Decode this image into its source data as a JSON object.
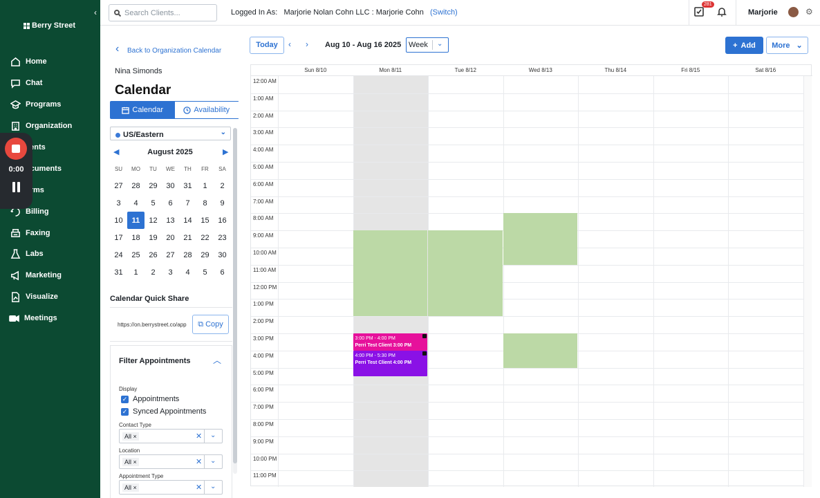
{
  "brand": {
    "name": "Berry Street"
  },
  "sidebar": {
    "items": [
      {
        "label": "Home",
        "icon": "home-icon"
      },
      {
        "label": "Chat",
        "icon": "chat-icon"
      },
      {
        "label": "Programs",
        "icon": "programs-icon"
      },
      {
        "label": "Organization",
        "icon": "organization-icon"
      },
      {
        "label": "lients",
        "icon": "clients-icon"
      },
      {
        "label": "ocuments",
        "icon": "documents-icon"
      },
      {
        "label": "orms",
        "icon": "forms-icon"
      },
      {
        "label": "Billing",
        "icon": "billing-icon"
      },
      {
        "label": "Faxing",
        "icon": "faxing-icon"
      },
      {
        "label": "Labs",
        "icon": "labs-icon"
      },
      {
        "label": "Marketing",
        "icon": "marketing-icon"
      },
      {
        "label": "Visualize",
        "icon": "visualize-icon"
      },
      {
        "label": "Meetings",
        "icon": "meetings-icon"
      }
    ]
  },
  "recorder": {
    "time": "0:00"
  },
  "topbar": {
    "search_placeholder": "Search Clients...",
    "logged_in_label": "Logged In As:",
    "logged_in_value": "Marjorie Nolan Cohn LLC : Marjorie Cohn",
    "switch_label": "(Switch)",
    "task_badge": "281",
    "user_name": "Marjorie"
  },
  "left": {
    "back_label": "Back to Organization Calendar",
    "person": "Nina Simonds",
    "title": "Calendar",
    "tab_calendar": "Calendar",
    "tab_availability": "Availability",
    "timezone": "US/Eastern",
    "month_title": "August 2025",
    "weekdays": [
      "SU",
      "MO",
      "TU",
      "WE",
      "TH",
      "FR",
      "SA"
    ],
    "weeks": [
      [
        "27",
        "28",
        "29",
        "30",
        "31",
        "1",
        "2"
      ],
      [
        "3",
        "4",
        "5",
        "6",
        "7",
        "8",
        "9"
      ],
      [
        "10",
        "11",
        "12",
        "13",
        "14",
        "15",
        "16"
      ],
      [
        "17",
        "18",
        "19",
        "20",
        "21",
        "22",
        "23"
      ],
      [
        "24",
        "25",
        "26",
        "27",
        "28",
        "29",
        "30"
      ],
      [
        "31",
        "1",
        "2",
        "3",
        "4",
        "5",
        "6"
      ]
    ],
    "selected_day": "11",
    "quick_share_title": "Calendar Quick Share",
    "quick_share_link": "https://on.berrystreet.co/app",
    "copy_label": "Copy",
    "filter_title": "Filter Appointments",
    "display_label": "Display",
    "check_appointments": "Appointments",
    "check_synced": "Synced Appointments",
    "contact_type_label": "Contact Type",
    "contact_type_value": "All",
    "location_label": "Location",
    "location_value": "All",
    "appt_type_label": "Appointment Type",
    "appt_type_value": "All"
  },
  "toolbar": {
    "today_label": "Today",
    "range": "Aug 10 - Aug 16 2025",
    "view": "Week",
    "add_label": "Add",
    "more_label": "More"
  },
  "calendar": {
    "days": [
      "Sun 8/10",
      "Mon 8/11",
      "Tue 8/12",
      "Wed 8/13",
      "Thu 8/14",
      "Fri 8/15",
      "Sat 8/16"
    ],
    "hours": [
      "12:00 AM",
      "1:00 AM",
      "2:00 AM",
      "3:00 AM",
      "4:00 AM",
      "5:00 AM",
      "6:00 AM",
      "7:00 AM",
      "8:00 AM",
      "9:00 AM",
      "10:00 AM",
      "11:00 AM",
      "12:00 PM",
      "1:00 PM",
      "2:00 PM",
      "3:00 PM",
      "4:00 PM",
      "5:00 PM",
      "6:00 PM",
      "7:00 PM",
      "8:00 PM",
      "9:00 PM",
      "10:00 PM",
      "11:00 PM"
    ],
    "appointments": [
      {
        "time": "3:00 PM - 4:00 PM",
        "title": "Perri Test Client 3:00 PM",
        "color": "#e6119b"
      },
      {
        "time": "4:00 PM - 5:30 PM",
        "title": "Perri Test Client 4:00 PM",
        "color": "#8a11e6"
      }
    ],
    "availability_color": "#bcd9a6"
  }
}
